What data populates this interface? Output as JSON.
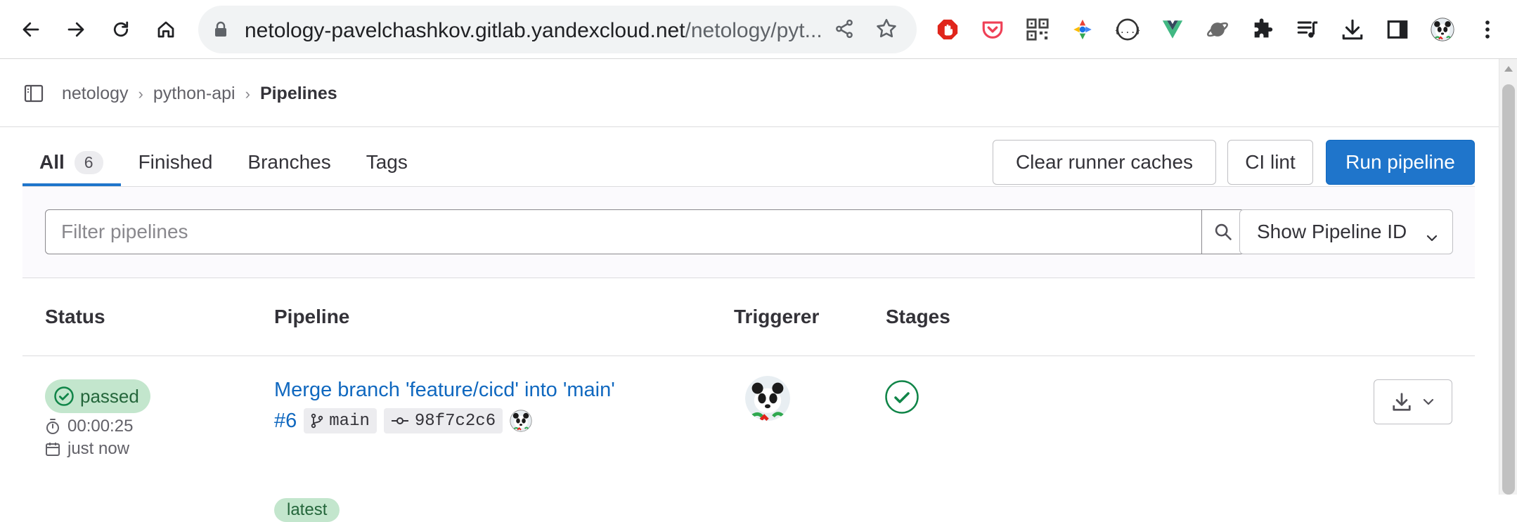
{
  "browser": {
    "url_host": "netology-pavelchashkov.gitlab.yandexcloud.net",
    "url_path": "/netology/pyt...",
    "nav": [
      "back-icon",
      "forward-icon",
      "reload-icon",
      "home-icon"
    ],
    "extensions": [
      "adblock-icon",
      "pocket-icon",
      "qr-code-icon",
      "color-picker-icon",
      "json-viewer-icon",
      "vue-devtools-icon",
      "planet-icon",
      "extensions-icon",
      "media-playlist-icon",
      "downloads-icon",
      "side-panel-icon",
      "profile-avatar",
      "menu-icon"
    ]
  },
  "breadcrumbs": {
    "items": [
      "netology",
      "python-api"
    ],
    "current": "Pipelines"
  },
  "tabs": [
    {
      "label": "All",
      "count": "6",
      "active": true
    },
    {
      "label": "Finished"
    },
    {
      "label": "Branches"
    },
    {
      "label": "Tags"
    }
  ],
  "actions": {
    "clear_caches": "Clear runner caches",
    "ci_lint": "CI lint",
    "run_pipeline": "Run pipeline"
  },
  "filter": {
    "placeholder": "Filter pipelines",
    "value": "",
    "dropdown_label": "Show Pipeline ID"
  },
  "table": {
    "headers": {
      "status": "Status",
      "pipeline": "Pipeline",
      "triggerer": "Triggerer",
      "stages": "Stages"
    },
    "rows": [
      {
        "status": "passed",
        "duration": "00:00:25",
        "finished": "just now",
        "title": "Merge branch 'feature/cicd' into 'main'",
        "id": "#6",
        "branch": "main",
        "commit": "98f7c2c6",
        "tag": "latest",
        "stage_status": "success"
      }
    ]
  },
  "colors": {
    "primary": "#1f75cb",
    "link": "#1068bf",
    "success_bg": "#c3e6cd",
    "success_fg": "#24663b",
    "success_icon": "#108548"
  }
}
